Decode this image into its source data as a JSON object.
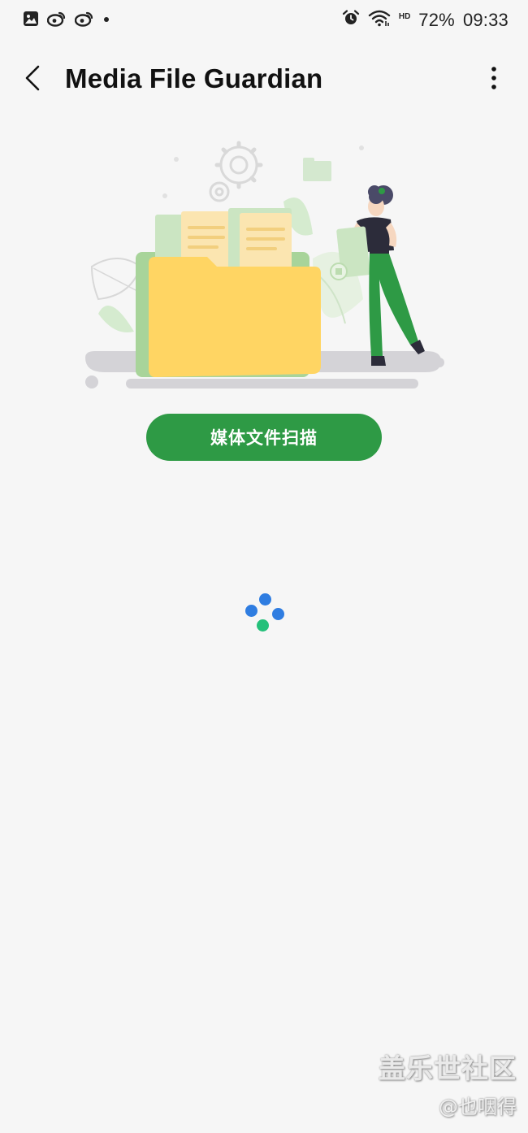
{
  "status_bar": {
    "battery": "72%",
    "time": "09:33",
    "network_badge": "HD",
    "icons_left": [
      "gallery-icon",
      "weibo-icon",
      "weibo-icon",
      "dot-icon"
    ],
    "icons_right": [
      "alarm-icon",
      "wifi-icon",
      "hd-badge"
    ]
  },
  "app_bar": {
    "title": "Media File Guardian",
    "back_icon": "chevron-left-icon",
    "menu_icon": "more-vertical-icon"
  },
  "main": {
    "illustration_icon": "folder-with-documents-and-person-illustration",
    "scan_button_label": "媒体文件扫描",
    "loading_dot_colors": [
      "#2f7de1",
      "#2f7de1",
      "#2f7de1",
      "#24c07a"
    ]
  },
  "watermark": {
    "main": "盖乐世社区",
    "sub": "@也咽得"
  },
  "colors": {
    "background": "#f6f6f6",
    "accent_green": "#2e9a45",
    "folder_yellow": "#ffd563",
    "loading_blue": "#2f7de1",
    "loading_green": "#24c07a"
  }
}
